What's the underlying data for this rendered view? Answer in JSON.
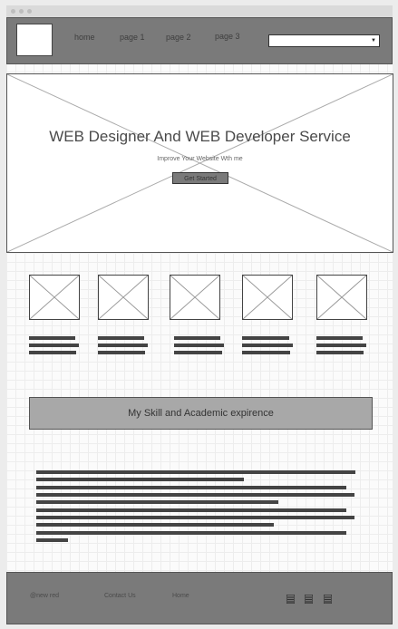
{
  "header": {
    "nav": [
      "home",
      "page 1",
      "page 2",
      "page 3"
    ],
    "dropdown_icon": "caret-down-icon"
  },
  "hero": {
    "title": "WEB Designer And WEB Developer Service",
    "subtitle": "Improve Your Website Wth me",
    "button_label": "Get Started"
  },
  "section": {
    "title": "My Skill and Academic expirence"
  },
  "footer": {
    "links": [
      "@new red",
      "Contact Us",
      "Home"
    ],
    "icons": [
      "list-icon",
      "list-icon",
      "list-icon"
    ]
  },
  "colors": {
    "header_bg": "#7a7a7a",
    "section_bg": "#a8a8a8",
    "text_bar": "#444444"
  }
}
